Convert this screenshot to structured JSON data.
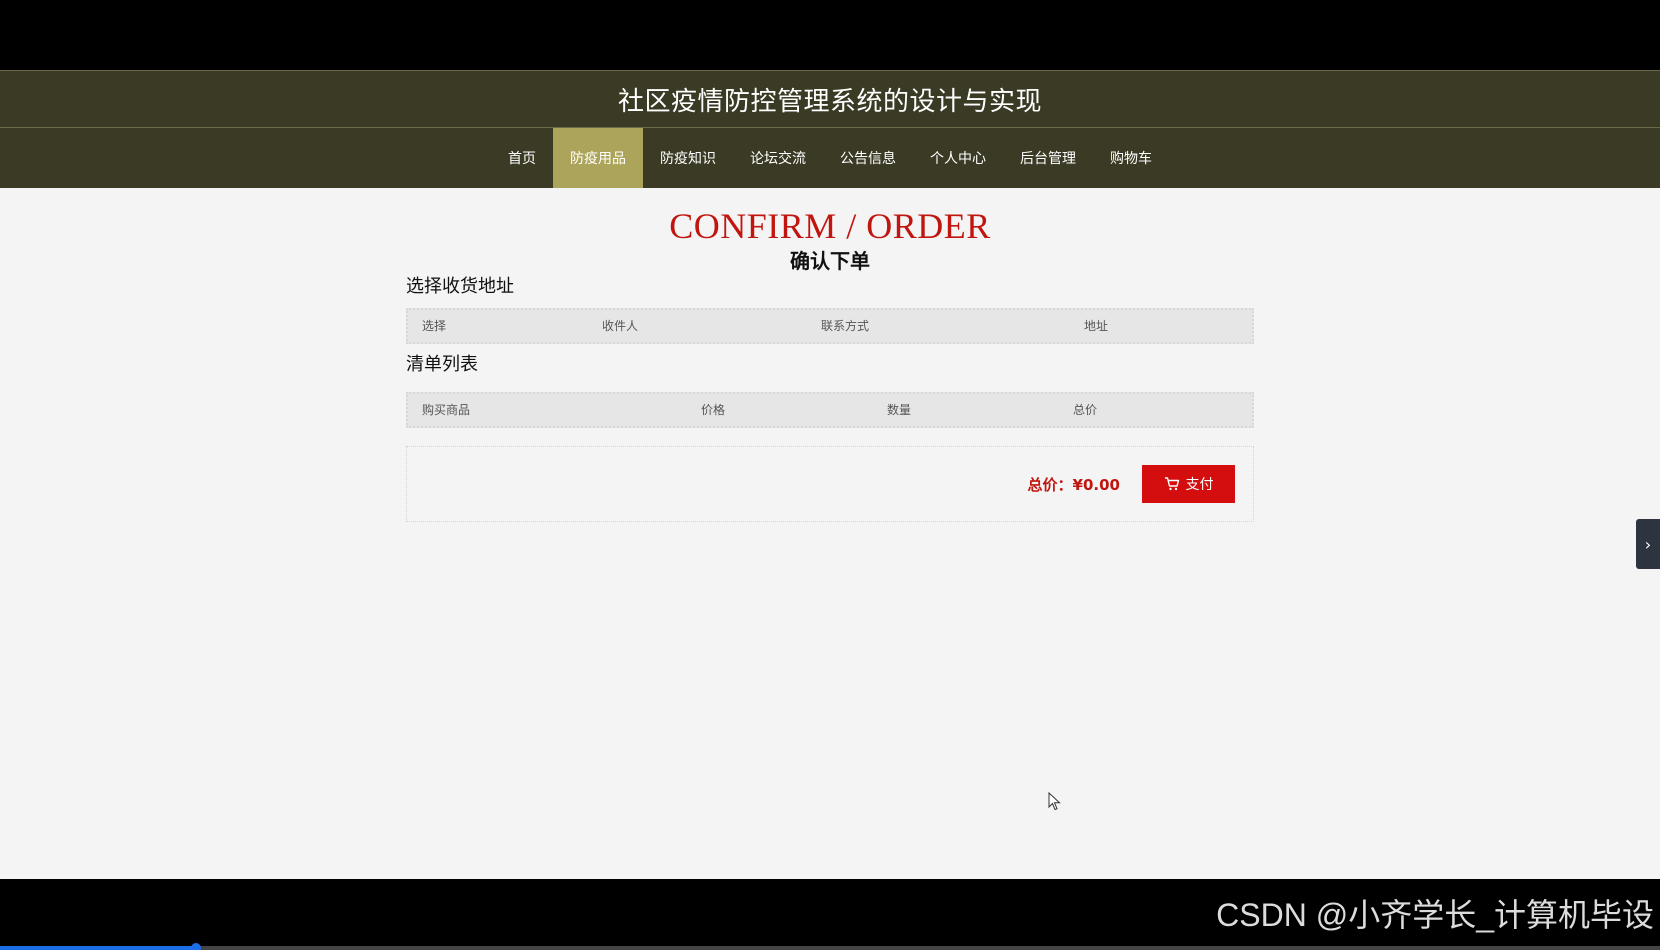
{
  "app": {
    "title": "社区疫情防控管理系统的设计与实现"
  },
  "nav": {
    "items": [
      {
        "label": "首页",
        "active": false
      },
      {
        "label": "防疫用品",
        "active": true
      },
      {
        "label": "防疫知识",
        "active": false
      },
      {
        "label": "论坛交流",
        "active": false
      },
      {
        "label": "公告信息",
        "active": false
      },
      {
        "label": "个人中心",
        "active": false
      },
      {
        "label": "后台管理",
        "active": false
      },
      {
        "label": "购物车",
        "active": false
      }
    ]
  },
  "page": {
    "heading_en": "CONFIRM / ORDER",
    "heading_cn": "确认下单"
  },
  "address_section": {
    "title": "选择收货地址",
    "columns": [
      "选择",
      "收件人",
      "联系方式",
      "地址"
    ]
  },
  "order_list": {
    "title": "清单列表",
    "columns": [
      "购买商品",
      "价格",
      "数量",
      "总价"
    ]
  },
  "summary": {
    "total_label": "总价：",
    "total_value": "¥0.00",
    "pay_label": "支付"
  },
  "side_tab": {
    "glyph": "›"
  },
  "video": {
    "progress_fraction": 0.118
  },
  "watermark": {
    "text": "CSDN @小齐学长_计算机毕设"
  },
  "colors": {
    "header_bg": "#3b3a24",
    "nav_active": "#aba45a",
    "accent_red": "#c0160f",
    "button_red": "#d40e0e",
    "progress_blue": "#1a6fe6"
  }
}
